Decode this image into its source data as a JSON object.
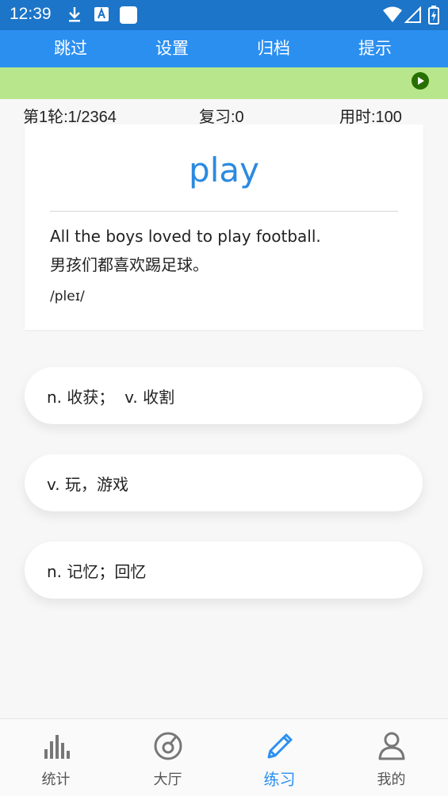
{
  "status_bar": {
    "time": "12:39",
    "icons": [
      "download-icon",
      "font-icon",
      "app-square-icon",
      "wifi-icon",
      "signal-icon",
      "battery-icon"
    ]
  },
  "top_nav": {
    "items": [
      {
        "label": "跳过"
      },
      {
        "label": "设置"
      },
      {
        "label": "归档"
      },
      {
        "label": "提示"
      }
    ]
  },
  "stats": {
    "round": "第1轮:1/2364",
    "review": "复习:0",
    "time_used": "用时:100"
  },
  "card": {
    "word": "play",
    "example_en": "All the boys loved to play football.",
    "example_zh": "男孩们都喜欢踢足球。",
    "phonetic": "/pleɪ/"
  },
  "options": [
    {
      "label": "n. 收获；  v. 收割"
    },
    {
      "label": "v. 玩，游戏"
    },
    {
      "label": "n. 记忆；回忆"
    }
  ],
  "bottom_nav": {
    "tabs": [
      {
        "label": "统计",
        "icon": "bar-chart-icon"
      },
      {
        "label": "大厅",
        "icon": "target-icon"
      },
      {
        "label": "练习",
        "icon": "pencil-icon",
        "active": true
      },
      {
        "label": "我的",
        "icon": "user-icon"
      }
    ]
  },
  "colors": {
    "status_bar": "#1c75c8",
    "top_nav": "#2b8ff0",
    "banner": "#b8e68c",
    "word": "#2b8ae0",
    "active_tab": "#2b8ff0"
  }
}
